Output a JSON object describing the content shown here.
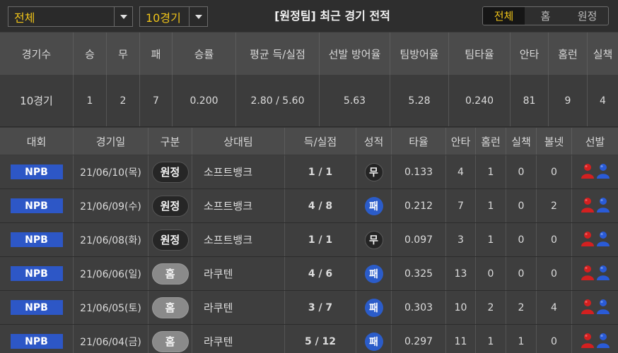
{
  "filters": {
    "league": "전체",
    "games": "10경기"
  },
  "title": "[원정팀] 최근 경기 전적",
  "tabs": [
    "전체",
    "홈",
    "원정"
  ],
  "summary": {
    "headers": [
      "경기수",
      "승",
      "무",
      "패",
      "승률",
      "평균 득/실점",
      "선발 방어율",
      "팀방어율",
      "팀타율",
      "안타",
      "홈런",
      "실책"
    ],
    "values": [
      "10경기",
      "1",
      "2",
      "7",
      "0.200",
      "2.80 / 5.60",
      "5.63",
      "5.28",
      "0.240",
      "81",
      "9",
      "4"
    ]
  },
  "games": {
    "headers": [
      "대회",
      "경기일",
      "구분",
      "상대팀",
      "득/실점",
      "성적",
      "타율",
      "안타",
      "홈런",
      "실책",
      "볼넷",
      "선발"
    ],
    "rows": [
      {
        "league": "NPB",
        "date": "21/06/10(목)",
        "venue": "원정",
        "venue_type": "away",
        "opponent": "소프트뱅크",
        "score": "1 / 1",
        "result": "무",
        "result_type": "draw",
        "avg": "0.133",
        "hits": "4",
        "hr": "1",
        "err": "0",
        "bb": "0"
      },
      {
        "league": "NPB",
        "date": "21/06/09(수)",
        "venue": "원정",
        "venue_type": "away",
        "opponent": "소프트뱅크",
        "score": "4 / 8",
        "result": "패",
        "result_type": "loss",
        "avg": "0.212",
        "hits": "7",
        "hr": "1",
        "err": "0",
        "bb": "2"
      },
      {
        "league": "NPB",
        "date": "21/06/08(화)",
        "venue": "원정",
        "venue_type": "away",
        "opponent": "소프트뱅크",
        "score": "1 / 1",
        "result": "무",
        "result_type": "draw",
        "avg": "0.097",
        "hits": "3",
        "hr": "1",
        "err": "0",
        "bb": "0"
      },
      {
        "league": "NPB",
        "date": "21/06/06(일)",
        "venue": "홈",
        "venue_type": "home",
        "opponent": "라쿠텐",
        "score": "4 / 6",
        "result": "패",
        "result_type": "loss",
        "avg": "0.325",
        "hits": "13",
        "hr": "0",
        "err": "0",
        "bb": "0"
      },
      {
        "league": "NPB",
        "date": "21/06/05(토)",
        "venue": "홈",
        "venue_type": "home",
        "opponent": "라쿠텐",
        "score": "3 / 7",
        "result": "패",
        "result_type": "loss",
        "avg": "0.303",
        "hits": "10",
        "hr": "2",
        "err": "2",
        "bb": "4"
      },
      {
        "league": "NPB",
        "date": "21/06/04(금)",
        "venue": "홈",
        "venue_type": "home",
        "opponent": "라쿠텐",
        "score": "5 / 12",
        "result": "패",
        "result_type": "loss",
        "avg": "0.297",
        "hits": "11",
        "hr": "1",
        "err": "1",
        "bb": "0"
      }
    ]
  },
  "colors": {
    "accent": "#f0c419",
    "badge_blue": "#2d57c6",
    "away_pitcher": "#d32020",
    "home_pitcher": "#2a5bd7"
  },
  "icons": {
    "dropdown": "chevron-down-icon",
    "pitcher_away": "red-person-icon",
    "pitcher_home": "blue-person-icon"
  }
}
